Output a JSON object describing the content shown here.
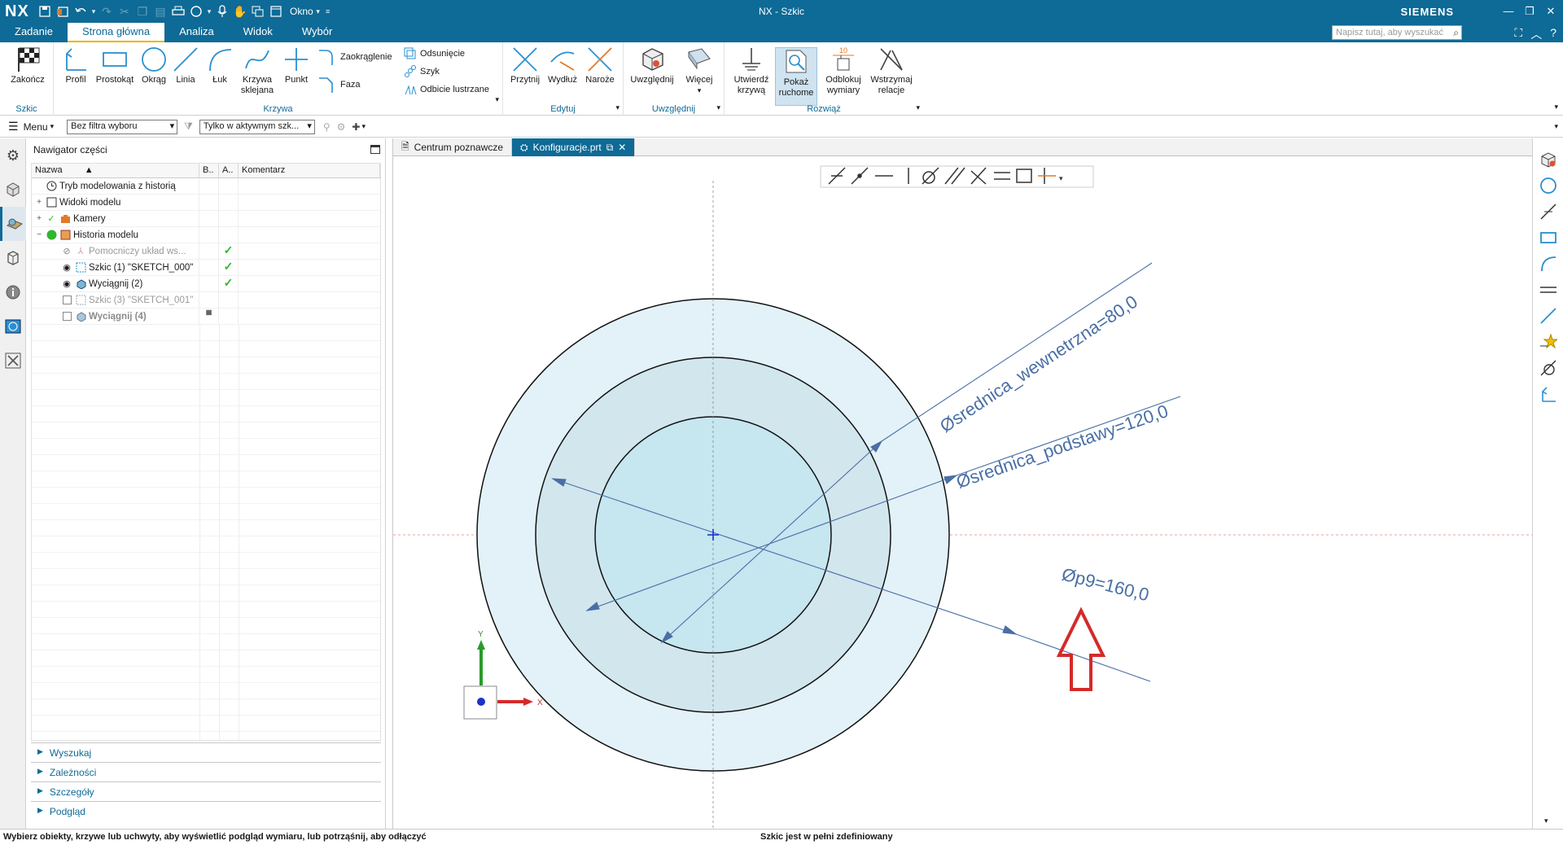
{
  "titlebar": {
    "logo": "NX",
    "okno_label": "Okno",
    "title": "NX - Szkic",
    "brand": "SIEMENS"
  },
  "menu": {
    "tabs": [
      "Zadanie",
      "Strona główna",
      "Analiza",
      "Widok",
      "Wybór"
    ],
    "active_tab": "Strona główna",
    "search_placeholder": "Napisz tutaj, aby wyszukać"
  },
  "ribbon": {
    "szkic": {
      "finish": "Zakończ",
      "group_label": "Szkic"
    },
    "krzywa": {
      "profil": "Profil",
      "prostokat": "Prostokąt",
      "okrag": "Okrąg",
      "linia": "Linia",
      "luk": "Łuk",
      "krzywa_sklejana_1": "Krzywa",
      "krzywa_sklejana_2": "sklejana",
      "punkt": "Punkt",
      "zaokraglenie": "Zaokrąglenie",
      "faza": "Faza",
      "odsuniecie": "Odsunięcie",
      "szyk": "Szyk",
      "odbicie": "Odbicie lustrzane",
      "group_label": "Krzywa"
    },
    "edytuj": {
      "przytnij": "Przytnij",
      "wydluz": "Wydłuż",
      "naroze": "Naroże",
      "group_label": "Edytuj"
    },
    "uwzglednij": {
      "uwzglednij": "Uwzględnij",
      "wiecej": "Więcej",
      "group_label": "Uwzględnij"
    },
    "rozwiaz": {
      "utwierdz_1": "Utwierdź",
      "utwierdz_2": "krzywą",
      "pokaz_1": "Pokaż",
      "pokaz_2": "ruchome",
      "odblokuj_1": "Odblokuj",
      "odblokuj_2": "wymiary",
      "wstrzymaj_1": "Wstrzymaj",
      "wstrzymaj_2": "relacje",
      "group_label": "Rozwiąż",
      "badge": "10"
    }
  },
  "selection_bar": {
    "menu_label": "Menu",
    "filter": "Bez filtra wyboru",
    "scope": "Tylko w aktywnym szk..."
  },
  "navigator": {
    "title": "Nawigator części",
    "columns": [
      "Nazwa",
      "B..",
      "A..",
      "Komentarz"
    ],
    "rows": [
      {
        "name": "Tryb modelowania z historią",
        "style": "normal",
        "check": ""
      },
      {
        "name": "Widoki modelu",
        "style": "normal",
        "check": ""
      },
      {
        "name": "Kamery",
        "style": "normal",
        "check": ""
      },
      {
        "name": "Historia modelu",
        "style": "normal",
        "check": ""
      },
      {
        "name": "Pomocniczy układ ws...",
        "style": "dim",
        "check": "✓"
      },
      {
        "name": "Szkic (1) \"SKETCH_000\"",
        "style": "normal",
        "check": "✓"
      },
      {
        "name": "Wyciągnij (2)",
        "style": "normal",
        "check": "✓"
      },
      {
        "name": "Szkic (3) \"SKETCH_001\"",
        "style": "dim",
        "check": ""
      },
      {
        "name": "Wyciągnij (4)",
        "style": "bold-dim",
        "check": ""
      }
    ],
    "sections": [
      "Wyszukaj",
      "Zależności",
      "Szczegóły",
      "Podgląd"
    ]
  },
  "doc_tabs": {
    "tab1": "Centrum poznawcze",
    "tab2": "Konfiguracje.prt"
  },
  "sketch": {
    "dim_inner": "Øsrednica_wewnetrzna=80,0",
    "dim_base": "Øsrednica_podstawy=120,0",
    "dim_outer": "Øp9=160,0",
    "axis_x": "X",
    "axis_y": "Y"
  },
  "status": {
    "left": "Wybierz obiekty, krzywe lub uchwyty, aby wyświetlić podgląd wymiaru, lub potrząśnij, aby odłączyć",
    "center": "Szkic jest w pełni zdefiniowany"
  },
  "colors": {
    "titlebar": "#0e6a96",
    "dimension": "#4a6fa5",
    "annotation_arrow": "#d42a2a",
    "ring_outer": "#e3f2f8",
    "ring_mid": "#d2e6ee",
    "ring_inner": "#c6e6f0"
  }
}
